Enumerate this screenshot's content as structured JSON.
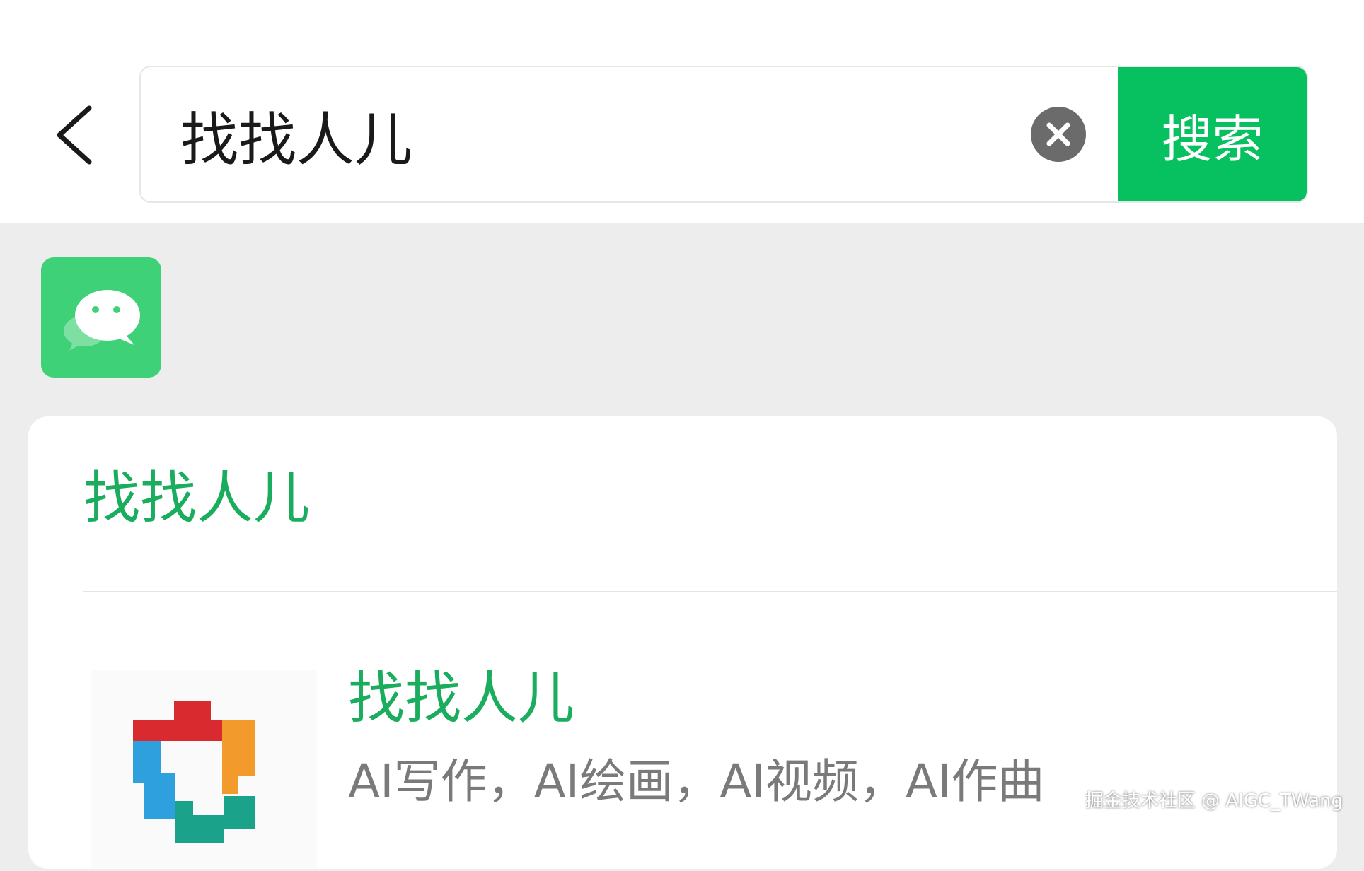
{
  "colors": {
    "header_bg": "#ffffff",
    "page_bg": "#ededed",
    "accent_green": "#07c160",
    "result_green": "#1aad5e",
    "desc_gray": "#7a7a7a",
    "tile_green": "#3fd178"
  },
  "header": {
    "back_icon": "chevron-left-icon",
    "search": {
      "value": "找找人儿",
      "clear_icon": "clear-icon"
    },
    "search_button_label": "搜索"
  },
  "app_tile": {
    "icon": "wechat-icon"
  },
  "result_card": {
    "title": "找找人儿",
    "item": {
      "logo_icon": "app-logo-icon",
      "title": "找找人儿",
      "description": "AI写作，AI绘画，AI视频，AI作曲"
    }
  },
  "watermark": "掘金技术社区 @ AIGC_TWang"
}
